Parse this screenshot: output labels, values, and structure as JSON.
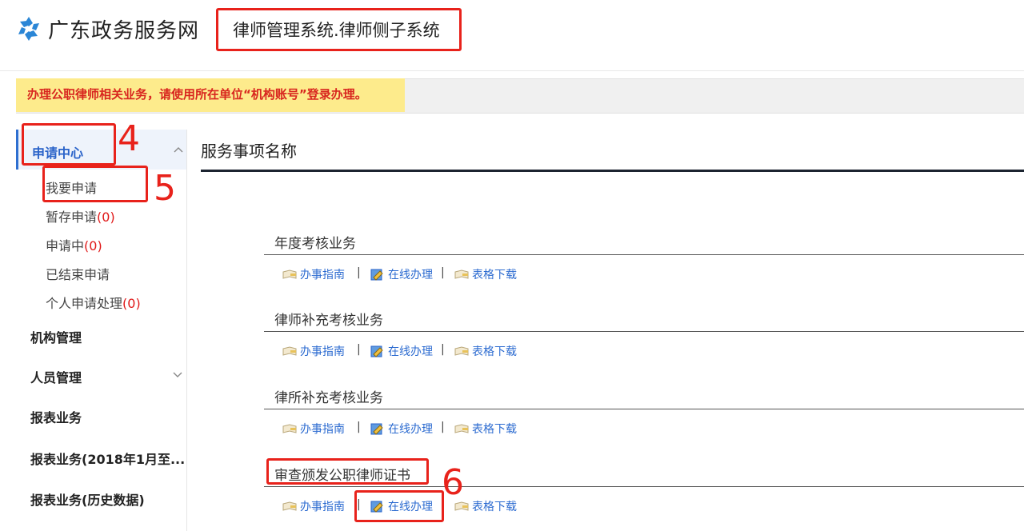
{
  "header": {
    "site_name": "广东政务服务网",
    "system_title": "律师管理系统.律师侧子系统",
    "logo_icon": "gd-gov-logo-icon"
  },
  "notice": "办理公职律师相关业务，请使用所在单位“机构账号”登录办理。",
  "sidebar": {
    "groups": [
      {
        "label": "申请中心",
        "expanded": true
      },
      {
        "label": "机构管理"
      },
      {
        "label": "人员管理"
      },
      {
        "label": "报表业务"
      },
      {
        "label": "报表业务(2018年1月至..."
      },
      {
        "label": "报表业务(历史数据)"
      }
    ],
    "sub_items": [
      {
        "label": "我要申请"
      },
      {
        "label": "暂存申请",
        "count": "(0)"
      },
      {
        "label": "申请中",
        "count": "(0)"
      },
      {
        "label": "已结束申请"
      },
      {
        "label": "个人申请处理",
        "count": "(0)"
      }
    ]
  },
  "main": {
    "section_title": "服务事项名称",
    "actions": {
      "guide": "办事指南",
      "online": "在线办理",
      "download": "表格下载",
      "separator": "|"
    },
    "services": [
      {
        "name": "年度考核业务"
      },
      {
        "name": "律师补充考核业务"
      },
      {
        "name": "律所补充考核业务"
      },
      {
        "name": "审查颁发公职律师证书"
      }
    ]
  },
  "annotations": {
    "n4": "4",
    "n5": "5",
    "n6": "6"
  },
  "colors": {
    "annotation_red": "#e8221b",
    "link_blue": "#2c6bd0",
    "notice_bg": "#fdeb8c",
    "notice_text": "#d8261f",
    "count_red": "#e01818"
  }
}
